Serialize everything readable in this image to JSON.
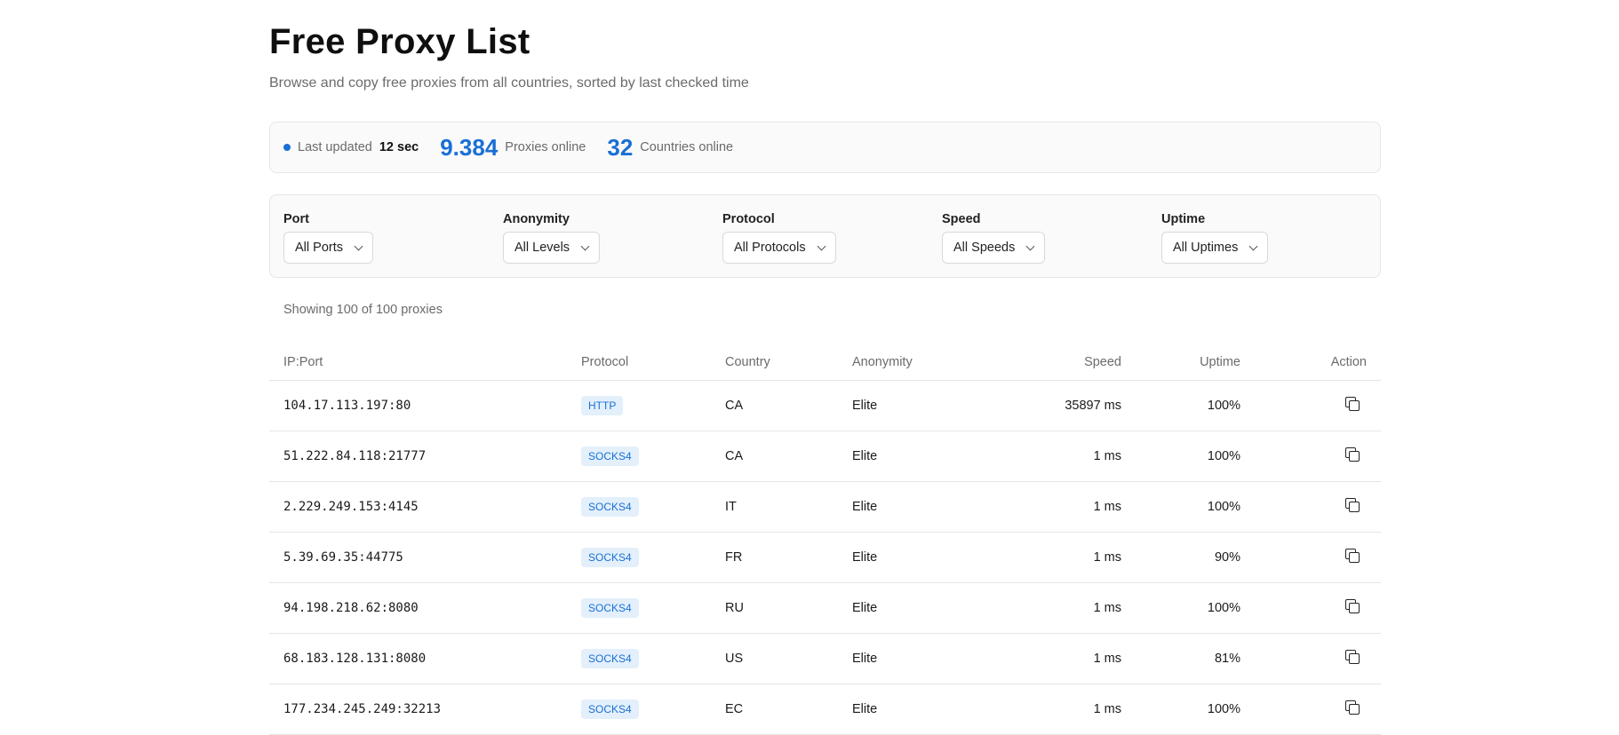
{
  "header": {
    "title": "Free Proxy List",
    "subtitle": "Browse and copy free proxies from all countries, sorted by last checked time"
  },
  "stats": {
    "last_updated_label": "Last updated",
    "last_updated_value": "12 sec",
    "proxies_count": "9.384",
    "proxies_label": "Proxies online",
    "countries_count": "32",
    "countries_label": "Countries online"
  },
  "filters": [
    {
      "label": "Port",
      "value": "All Ports"
    },
    {
      "label": "Anonymity",
      "value": "All Levels"
    },
    {
      "label": "Protocol",
      "value": "All Protocols"
    },
    {
      "label": "Speed",
      "value": "All Speeds"
    },
    {
      "label": "Uptime",
      "value": "All Uptimes"
    }
  ],
  "showing": "Showing 100 of 100 proxies",
  "table": {
    "columns": [
      "IP:Port",
      "Protocol",
      "Country",
      "Anonymity",
      "Speed",
      "Uptime",
      "Action"
    ],
    "rows": [
      {
        "ip": "104.17.113.197:80",
        "protocol": "HTTP",
        "country": "CA",
        "anonymity": "Elite",
        "speed": "35897 ms",
        "uptime": "100%"
      },
      {
        "ip": "51.222.84.118:21777",
        "protocol": "SOCKS4",
        "country": "CA",
        "anonymity": "Elite",
        "speed": "1 ms",
        "uptime": "100%"
      },
      {
        "ip": "2.229.249.153:4145",
        "protocol": "SOCKS4",
        "country": "IT",
        "anonymity": "Elite",
        "speed": "1 ms",
        "uptime": "100%"
      },
      {
        "ip": "5.39.69.35:44775",
        "protocol": "SOCKS4",
        "country": "FR",
        "anonymity": "Elite",
        "speed": "1 ms",
        "uptime": "90%"
      },
      {
        "ip": "94.198.218.62:8080",
        "protocol": "SOCKS4",
        "country": "RU",
        "anonymity": "Elite",
        "speed": "1 ms",
        "uptime": "100%"
      },
      {
        "ip": "68.183.128.131:8080",
        "protocol": "SOCKS4",
        "country": "US",
        "anonymity": "Elite",
        "speed": "1 ms",
        "uptime": "81%"
      },
      {
        "ip": "177.234.245.249:32213",
        "protocol": "SOCKS4",
        "country": "EC",
        "anonymity": "Elite",
        "speed": "1 ms",
        "uptime": "100%"
      }
    ]
  }
}
